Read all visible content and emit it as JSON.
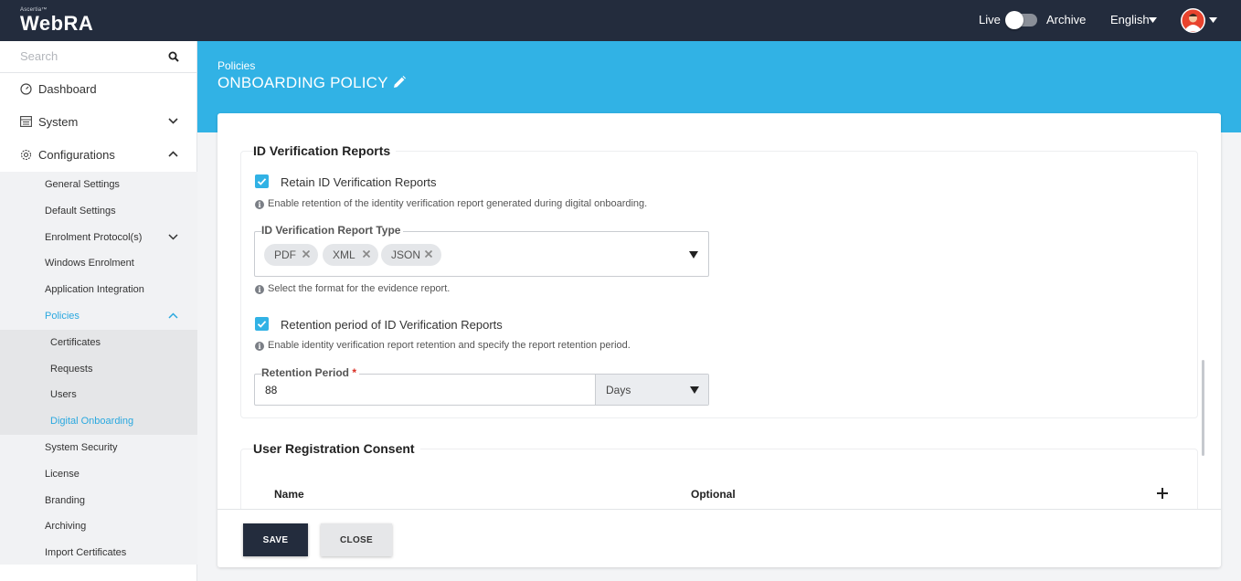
{
  "app": {
    "brand_small": "Ascertia™",
    "brand": "WebRA"
  },
  "topbar": {
    "live_label": "Live",
    "archive_label": "Archive",
    "language": "English"
  },
  "sidebar": {
    "search_placeholder": "Search",
    "top_items": [
      {
        "label": "Dashboard",
        "icon": "dashboard-icon"
      },
      {
        "label": "System",
        "icon": "system-icon"
      },
      {
        "label": "Configurations",
        "icon": "gear-icon"
      }
    ],
    "config_items": [
      "General Settings",
      "Default Settings",
      "Enrolment Protocol(s)",
      "Windows Enrolment",
      "Application Integration",
      "Policies"
    ],
    "policy_items": [
      "Certificates",
      "Requests",
      "Users",
      "Digital Onboarding"
    ],
    "more_items": [
      "System Security",
      "License",
      "Branding",
      "Archiving",
      "Import Certificates"
    ]
  },
  "header": {
    "breadcrumb": "Policies",
    "title": "ONBOARDING POLICY"
  },
  "id_reports": {
    "title": "ID Verification Reports",
    "retain_label": "Retain ID Verification Reports",
    "retain_checked": true,
    "retain_help": "Enable retention of the identity verification report generated during digital onboarding.",
    "type_label": "ID Verification Report Type",
    "types": [
      "PDF",
      "XML",
      "JSON"
    ],
    "type_help": "Select the format for the evidence report.",
    "retention_label": "Retention period of ID Verification Reports",
    "retention_checked": true,
    "retention_help": "Enable identity verification report retention and specify the report retention period.",
    "period_label": "Retention Period",
    "period_required": "*",
    "period_value": "88",
    "period_unit": "Days"
  },
  "consent": {
    "title": "User Registration Consent",
    "columns": [
      "Name",
      "Optional"
    ]
  },
  "footer": {
    "save": "SAVE",
    "close": "CLOSE"
  },
  "colors": {
    "accent": "#31b2e5",
    "dark": "#232c3d",
    "active_link": "#2aa8df"
  }
}
